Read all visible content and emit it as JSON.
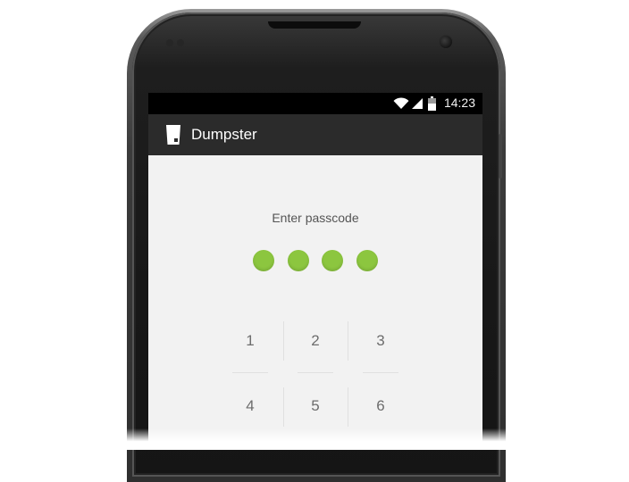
{
  "statusbar": {
    "time": "14:23"
  },
  "app": {
    "title": "Dumpster",
    "accent_color": "#8cc63f"
  },
  "lock": {
    "prompt": "Enter passcode",
    "entered_digits": 4,
    "keys": [
      "1",
      "2",
      "3",
      "4",
      "5",
      "6"
    ]
  },
  "icons": {
    "wifi": "wifi-icon",
    "signal": "signal-icon",
    "battery": "battery-icon",
    "app": "trash-bin-icon"
  }
}
